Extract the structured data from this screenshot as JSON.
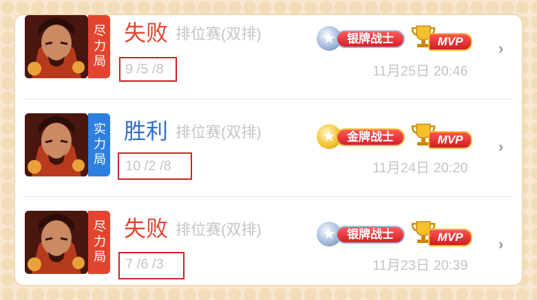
{
  "matches": [
    {
      "mode_label": "尽力局",
      "result": "失败",
      "game_type": "排位赛(双排)",
      "kda": "9 /5 /8",
      "rank_badge": "银牌战士",
      "mvp_label": "MVP",
      "datetime": "11月25日 20:46"
    },
    {
      "mode_label": "实力局",
      "result": "胜利",
      "game_type": "排位赛(双排)",
      "kda": "10 /2 /8",
      "rank_badge": "金牌战士",
      "mvp_label": "MVP",
      "datetime": "11月24日 20:20"
    },
    {
      "mode_label": "尽力局",
      "result": "失败",
      "game_type": "排位赛(双排)",
      "kda": "7 /6 /3",
      "rank_badge": "银牌战士",
      "mvp_label": "MVP",
      "datetime": "11月23日 20:39"
    }
  ],
  "icons": {
    "avatar": "hero-avatar",
    "rank": "rank-star-icon",
    "mvp": "trophy-icon",
    "chevron": "chevron-right-icon"
  },
  "colors": {
    "lose": "#e2442f",
    "win": "#2d6fc9",
    "mode_lose": "#e2442f",
    "mode_win": "#2d7fe0",
    "kda_highlight": "#cc2020"
  }
}
